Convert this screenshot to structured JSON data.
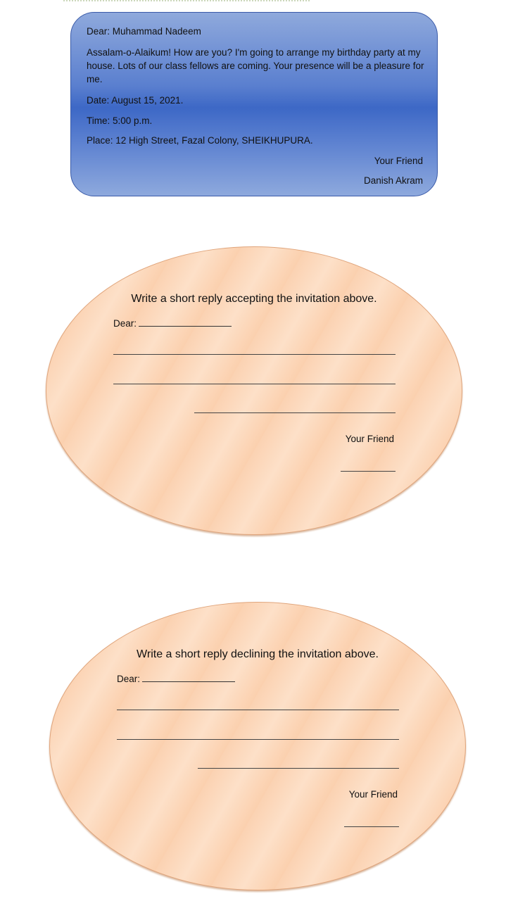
{
  "invitation": {
    "greeting": "Dear: Muhammad Nadeem",
    "body": "Assalam-o-Alaikum! How are you? I'm going to arrange my birthday party at my house. Lots of our class fellows are coming. Your presence will be a pleasure for me.",
    "date": "Date: August 15, 2021.",
    "time": "Time: 5:00 p.m.",
    "place": "Place: 12 High Street, Fazal Colony, SHEIKHUPURA.",
    "closing": "Your Friend",
    "signature": "Danish Akram"
  },
  "accept": {
    "prompt": "Write a short reply accepting the invitation above.",
    "dear": "Dear:",
    "closing": "Your Friend"
  },
  "decline": {
    "prompt": "Write a short reply declining the invitation above.",
    "dear": "Dear:",
    "closing": "Your Friend"
  }
}
